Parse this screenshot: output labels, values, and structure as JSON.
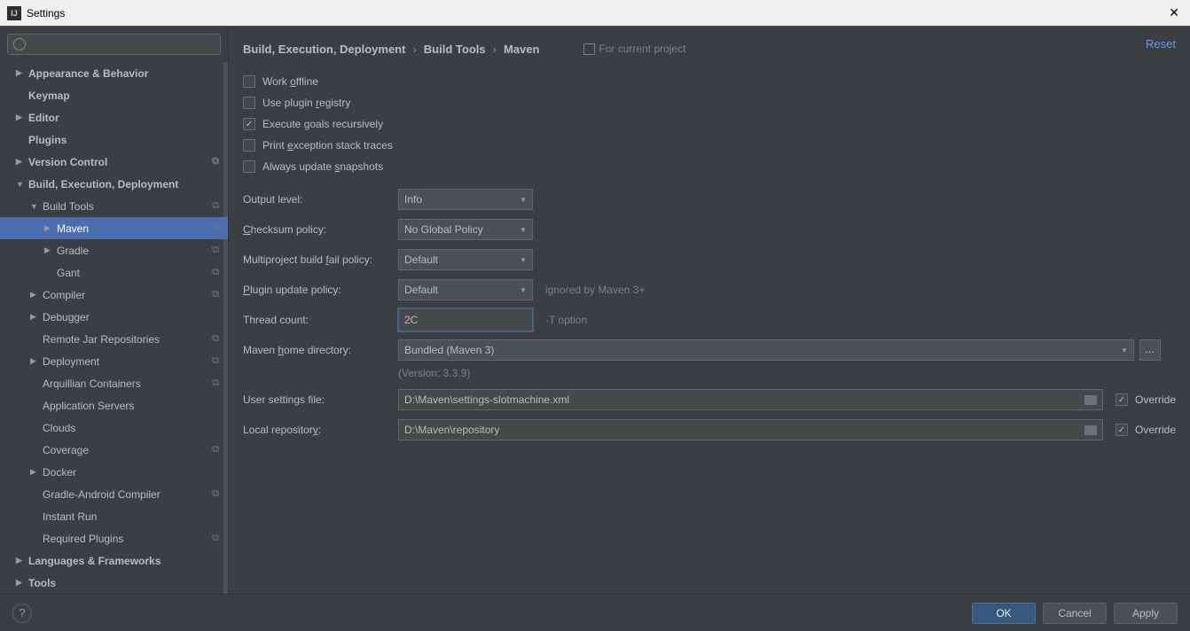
{
  "window": {
    "title": "Settings"
  },
  "search": {
    "placeholder": ""
  },
  "tree": {
    "items": [
      {
        "label": "Appearance & Behavior",
        "level": 1,
        "arrow": "right",
        "bold": true,
        "proj": false,
        "sel": false
      },
      {
        "label": "Keymap",
        "level": 1,
        "arrow": "none",
        "bold": true,
        "proj": false,
        "sel": false
      },
      {
        "label": "Editor",
        "level": 1,
        "arrow": "right",
        "bold": true,
        "proj": false,
        "sel": false
      },
      {
        "label": "Plugins",
        "level": 1,
        "arrow": "none",
        "bold": true,
        "proj": false,
        "sel": false
      },
      {
        "label": "Version Control",
        "level": 1,
        "arrow": "right",
        "bold": true,
        "proj": true,
        "sel": false
      },
      {
        "label": "Build, Execution, Deployment",
        "level": 1,
        "arrow": "down",
        "bold": true,
        "proj": false,
        "sel": false
      },
      {
        "label": "Build Tools",
        "level": 2,
        "arrow": "down",
        "bold": false,
        "proj": true,
        "sel": false
      },
      {
        "label": "Maven",
        "level": 3,
        "arrow": "right",
        "bold": false,
        "proj": true,
        "sel": true
      },
      {
        "label": "Gradle",
        "level": 3,
        "arrow": "right",
        "bold": false,
        "proj": true,
        "sel": false
      },
      {
        "label": "Gant",
        "level": 3,
        "arrow": "none",
        "bold": false,
        "proj": true,
        "sel": false
      },
      {
        "label": "Compiler",
        "level": 2,
        "arrow": "right",
        "bold": false,
        "proj": true,
        "sel": false
      },
      {
        "label": "Debugger",
        "level": 2,
        "arrow": "right",
        "bold": false,
        "proj": false,
        "sel": false
      },
      {
        "label": "Remote Jar Repositories",
        "level": 2,
        "arrow": "none",
        "bold": false,
        "proj": true,
        "sel": false
      },
      {
        "label": "Deployment",
        "level": 2,
        "arrow": "right",
        "bold": false,
        "proj": true,
        "sel": false
      },
      {
        "label": "Arquillian Containers",
        "level": 2,
        "arrow": "none",
        "bold": false,
        "proj": true,
        "sel": false
      },
      {
        "label": "Application Servers",
        "level": 2,
        "arrow": "none",
        "bold": false,
        "proj": false,
        "sel": false
      },
      {
        "label": "Clouds",
        "level": 2,
        "arrow": "none",
        "bold": false,
        "proj": false,
        "sel": false
      },
      {
        "label": "Coverage",
        "level": 2,
        "arrow": "none",
        "bold": false,
        "proj": true,
        "sel": false
      },
      {
        "label": "Docker",
        "level": 2,
        "arrow": "right",
        "bold": false,
        "proj": false,
        "sel": false
      },
      {
        "label": "Gradle-Android Compiler",
        "level": 2,
        "arrow": "none",
        "bold": false,
        "proj": true,
        "sel": false
      },
      {
        "label": "Instant Run",
        "level": 2,
        "arrow": "none",
        "bold": false,
        "proj": false,
        "sel": false
      },
      {
        "label": "Required Plugins",
        "level": 2,
        "arrow": "none",
        "bold": false,
        "proj": true,
        "sel": false
      },
      {
        "label": "Languages & Frameworks",
        "level": 1,
        "arrow": "right",
        "bold": true,
        "proj": false,
        "sel": false
      },
      {
        "label": "Tools",
        "level": 1,
        "arrow": "right",
        "bold": true,
        "proj": false,
        "sel": false
      }
    ]
  },
  "breadcrumb": {
    "a": "Build, Execution, Deployment",
    "b": "Build Tools",
    "c": "Maven",
    "note": "For current project",
    "reset": "Reset"
  },
  "checks": {
    "work_offline": "Work offline",
    "plugin_registry": "Use plugin registry",
    "exec_goals": "Execute goals recursively",
    "print_exc": "Print exception stack traces",
    "always_update": "Always update snapshots"
  },
  "fields": {
    "output_level": {
      "label": "Output level:",
      "value": "Info"
    },
    "checksum": {
      "label": "Checksum policy:",
      "value": "No Global Policy"
    },
    "multiproject": {
      "label": "Multiproject build fail policy:",
      "value": "Default"
    },
    "plugin_update": {
      "label": "Plugin update policy:",
      "value": "Default",
      "hint": "ignored by Maven 3+"
    },
    "thread_count": {
      "label": "Thread count:",
      "value": "2C",
      "hint": "-T option"
    },
    "maven_home": {
      "label": "Maven home directory:",
      "value": "Bundled (Maven 3)",
      "version": "(Version: 3.3.9)"
    },
    "user_settings": {
      "label": "User settings file:",
      "value": "D:\\Maven\\settings-slotmachine.xml",
      "override": "Override"
    },
    "local_repo": {
      "label": "Local repository:",
      "value": "D:\\Maven\\repository",
      "override": "Override"
    }
  },
  "footer": {
    "ok": "OK",
    "cancel": "Cancel",
    "apply": "Apply",
    "help": "?"
  },
  "browse": "..."
}
